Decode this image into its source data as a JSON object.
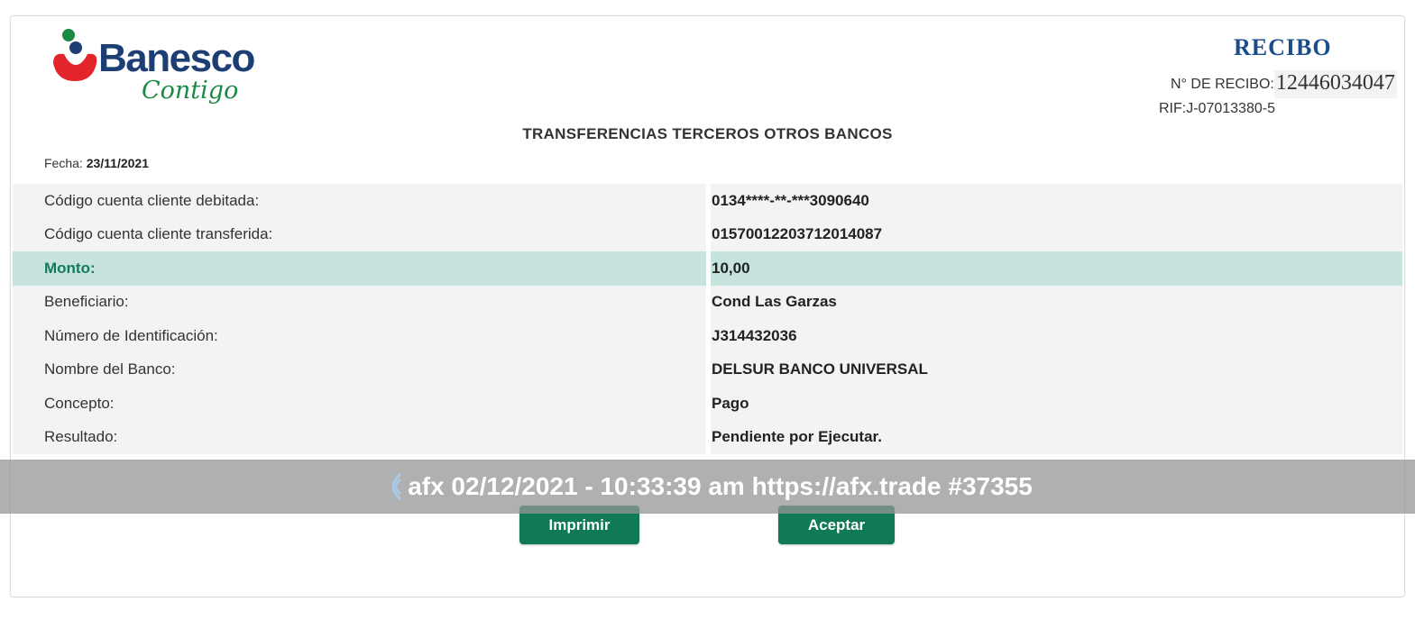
{
  "brand": {
    "name": "Banesco",
    "tagline": "Contigo",
    "colors": {
      "primary": "#1c3e74",
      "red": "#e3242b",
      "green": "#1b8a45"
    }
  },
  "receipt": {
    "title": "RECIBO",
    "number_label": "N° DE RECIBO:",
    "number": "12446034047",
    "rif": "RIF:J-07013380-5"
  },
  "document_title": "TRANSFERENCIAS TERCEROS OTROS BANCOS",
  "date": {
    "label": "Fecha:",
    "value": "23/11/2021"
  },
  "rows": [
    {
      "label": "Código cuenta cliente debitada:",
      "value": "0134****-**-***3090640",
      "highlight": false
    },
    {
      "label": "Código cuenta cliente transferida:",
      "value": "01570012203712014087",
      "highlight": false
    },
    {
      "label": "Monto:",
      "value": "10,00",
      "highlight": true
    },
    {
      "label": "Beneficiario:",
      "value": "Cond Las Garzas",
      "highlight": false
    },
    {
      "label": "Número de Identificación:",
      "value": "J314432036",
      "highlight": false
    },
    {
      "label": "Nombre del Banco:",
      "value": "DELSUR BANCO UNIVERSAL",
      "highlight": false
    },
    {
      "label": "Concepto:",
      "value": "Pago",
      "highlight": false
    },
    {
      "label": "Resultado:",
      "value": "Pendiente por Ejecutar.",
      "highlight": false
    }
  ],
  "actions": {
    "print_label": "Imprimir",
    "accept_label": "Aceptar",
    "button_color": "#0f7a55"
  },
  "watermark": {
    "text": "afx 02/12/2021 - 10:33:39 am https://afx.trade #37355",
    "icon": "afx-wave-icon"
  }
}
